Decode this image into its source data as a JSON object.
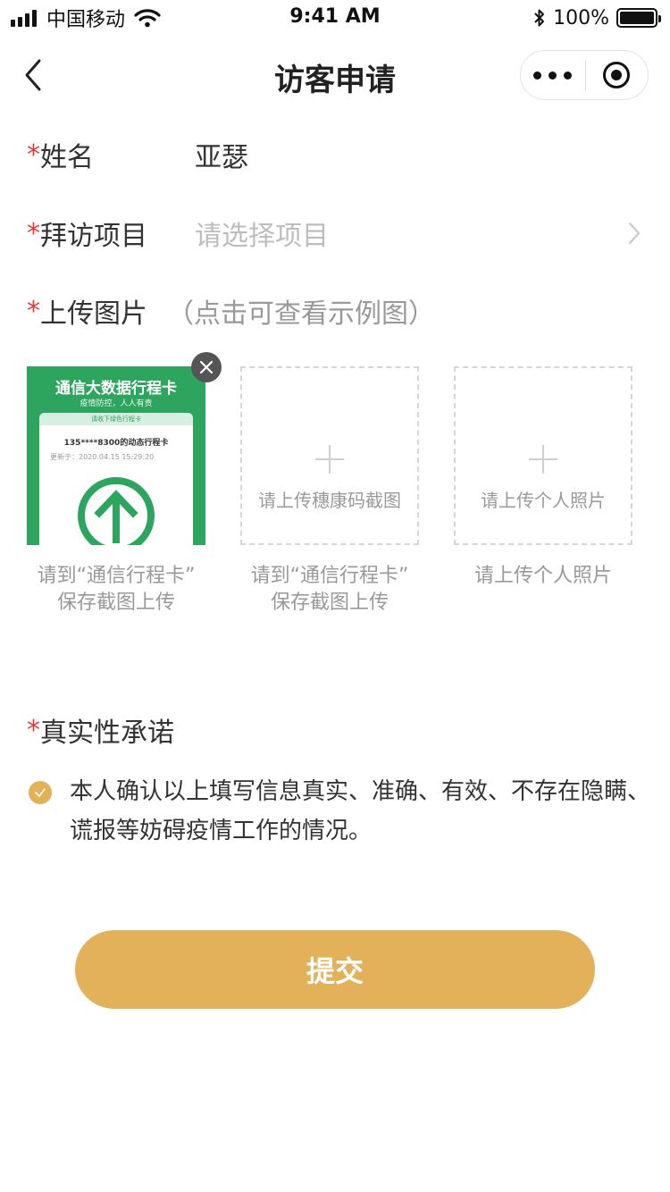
{
  "status_bar": {
    "carrier": "中国移动",
    "time": "9:41 AM",
    "battery_text": "100%",
    "battery_level": 1.0,
    "icons": [
      "signal-icon",
      "wifi-icon",
      "bluetooth-icon",
      "battery-icon"
    ]
  },
  "nav": {
    "title": "访客申请",
    "back_icon": "chevron-left-icon",
    "more_icon": "more-dots-icon",
    "close_icon": "target-circle-icon"
  },
  "form": {
    "required_mark": "*",
    "name": {
      "label": "姓名",
      "value": "亚瑟"
    },
    "project": {
      "label": "拜访项目",
      "placeholder": "请选择项目",
      "icon": "chevron-right-icon"
    },
    "upload": {
      "label": "上传图片",
      "hint": "（点击可查看示例图）",
      "items": [
        {
          "caption": "请到“通信行程卡”\n保存截图上传",
          "thumbnail": {
            "title": "通信大数据行程卡",
            "subtitle": "疫情防控，人人有责",
            "band": "请收下绿色行程卡",
            "phone_line": "135****8300的动态行程卡",
            "updated": "更新于：2020.04.15 15:29:20",
            "icon": "green-arrow-up-icon"
          },
          "remove_icon": "close-icon"
        },
        {
          "box_text": "请上传穗康码截图",
          "caption": "请到“通信行程卡”\n保存截图上传",
          "icon": "plus-icon"
        },
        {
          "box_text": "请上传个人照片",
          "caption": "请上传个人照片",
          "icon": "plus-icon"
        }
      ]
    },
    "commitment": {
      "label": "真实性承诺",
      "text": "本人确认以上填写信息真实、准确、有效、不存在隐瞒、谎报等妨碍疫情工作的情况。",
      "checked": true,
      "icon": "check-circle-icon"
    }
  },
  "submit": {
    "label": "提交"
  },
  "colors": {
    "accent": "#e2b159",
    "required": "#e23b3b",
    "card_green": "#2ea55f",
    "placeholder": "#bdbdbd",
    "muted": "#999999"
  }
}
